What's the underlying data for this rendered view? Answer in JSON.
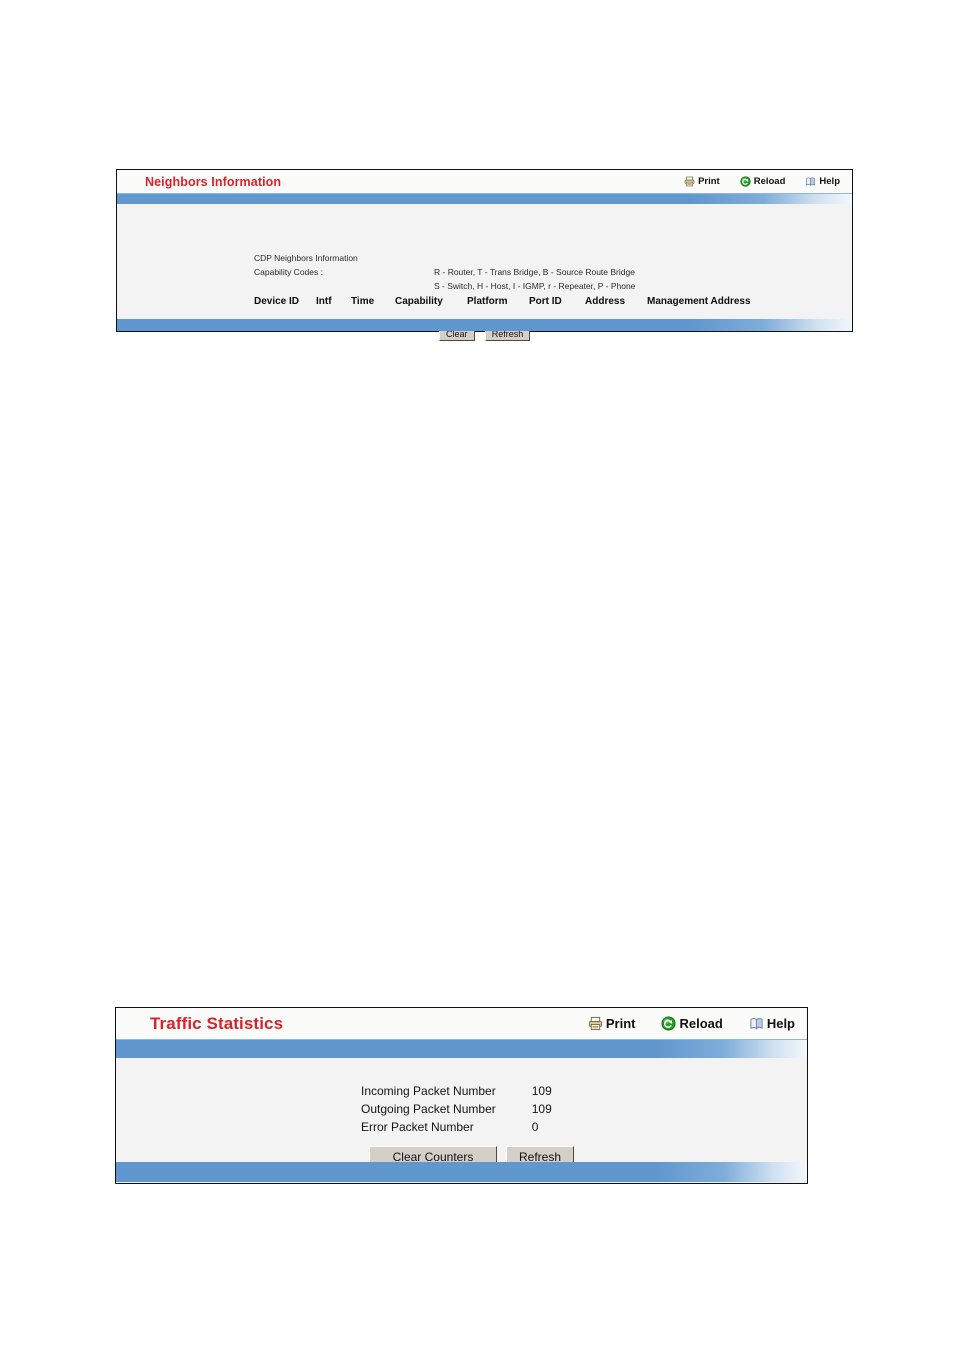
{
  "panels": [
    {
      "id": "neighbors",
      "title": "Neighbors Information",
      "actions": [
        {
          "icon": "printer-icon",
          "label": "Print"
        },
        {
          "icon": "reload-icon",
          "label": "Reload"
        },
        {
          "icon": "help-book-icon",
          "label": "Help"
        }
      ],
      "info": {
        "heading": "CDP Neighbors Information",
        "capability_label": "Capability Codes :",
        "capability_lines": [
          "R - Router, T - Trans Bridge, B - Source Route Bridge",
          "S - Switch, H - Host, I - IGMP, r - Repeater, P - Phone"
        ]
      },
      "table": {
        "columns": [
          "Device ID",
          "Intf",
          "Time",
          "Capability",
          "Platform",
          "Port ID",
          "Address",
          "Management Address"
        ],
        "rows": []
      },
      "buttons": [
        {
          "label": "Clear"
        },
        {
          "label": "Refresh"
        }
      ]
    },
    {
      "id": "traffic",
      "title": "Traffic Statistics",
      "actions": [
        {
          "icon": "printer-icon",
          "label": "Print"
        },
        {
          "icon": "reload-icon",
          "label": "Reload"
        },
        {
          "icon": "help-book-icon",
          "label": "Help"
        }
      ],
      "stats": [
        {
          "label": "Incoming Packet Number",
          "value": "109"
        },
        {
          "label": "Outgoing Packet Number",
          "value": "109"
        },
        {
          "label": "Error Packet Number",
          "value": "0"
        }
      ],
      "buttons": [
        {
          "label": "Clear Counters"
        },
        {
          "label": "Refresh"
        }
      ]
    }
  ],
  "colors": {
    "title_red": "#d8232a",
    "bar_blue": "#6097ce",
    "body_gray": "#f4f3f3",
    "button_face": "#d4d0c8",
    "reload_green": "#1f9e27",
    "printer_tan": "#e8cf8a",
    "help_blue": "#9fb8d8"
  }
}
